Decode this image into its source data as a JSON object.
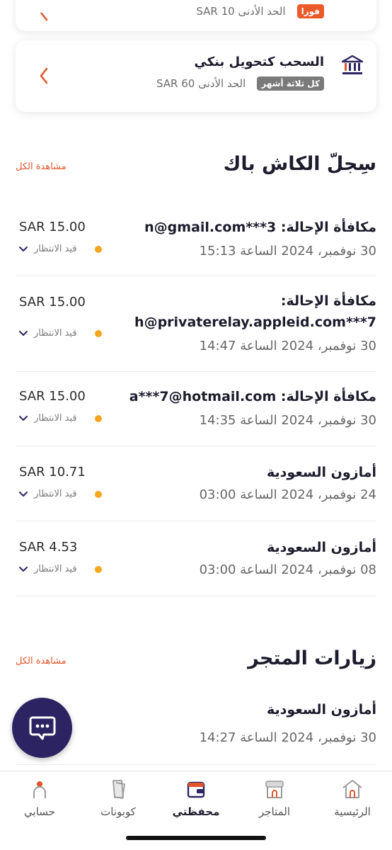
{
  "withdraw_options": [
    {
      "badge": "فورا",
      "min_label": "الحد الأدنى SAR 10"
    },
    {
      "title": "السحب كتحويل بنكي",
      "badge": "كل ثلاثة أشهر",
      "min_label": "الحد الأدنى SAR 60"
    }
  ],
  "cashback": {
    "title": "سِجلّ الكاش باك",
    "view_all": "مشاهدة الكل",
    "items": [
      {
        "title": "مكافأة الإحالة: n@gmail.com***3",
        "date": "30 نوفمبر، 2024 الساعة 15:13",
        "amount": "SAR 15.00",
        "status": "قيد الانتظار"
      },
      {
        "title_line1": "مكافأة الإحالة:",
        "title_line2": "h@privaterelay.appleid.com***7",
        "date": "30 نوفمبر، 2024 الساعة 14:47",
        "amount": "SAR 15.00",
        "status": "قيد الانتظار"
      },
      {
        "title": "مكافأة الإحالة: a***7@hotmail.com",
        "date": "30 نوفمبر، 2024 الساعة 14:35",
        "amount": "SAR 15.00",
        "status": "قيد الانتظار"
      },
      {
        "title": "أمازون السعودية",
        "date": "24 نوفمبر، 2024 الساعة 03:00",
        "amount": "SAR 10.71",
        "status": "قيد الانتظار"
      },
      {
        "title": "أمازون السعودية",
        "date": "08 نوفمبر، 2024 الساعة 03:00",
        "amount": "SAR 4.53",
        "status": "قيد الانتظار"
      }
    ]
  },
  "visits": {
    "title": "زيارات المتجر",
    "view_all": "مشاهدة الكل",
    "items": [
      {
        "title": "أمازون السعودية",
        "date": "30 نوفمبر، 2024 الساعة 14:27"
      }
    ]
  },
  "nav": {
    "items": [
      {
        "label": "الرئيسية",
        "icon": "home-icon"
      },
      {
        "label": "المتاجر",
        "icon": "store-icon"
      },
      {
        "label": "محفظتي",
        "icon": "wallet-icon",
        "active": true
      },
      {
        "label": "كوبونات",
        "icon": "coupon-icon"
      },
      {
        "label": "حسابي",
        "icon": "profile-icon"
      }
    ]
  },
  "colors": {
    "accent": "#e2552a",
    "status_pending": "#f5a623",
    "fab": "#2c2462",
    "title": "#1c1c2e"
  }
}
